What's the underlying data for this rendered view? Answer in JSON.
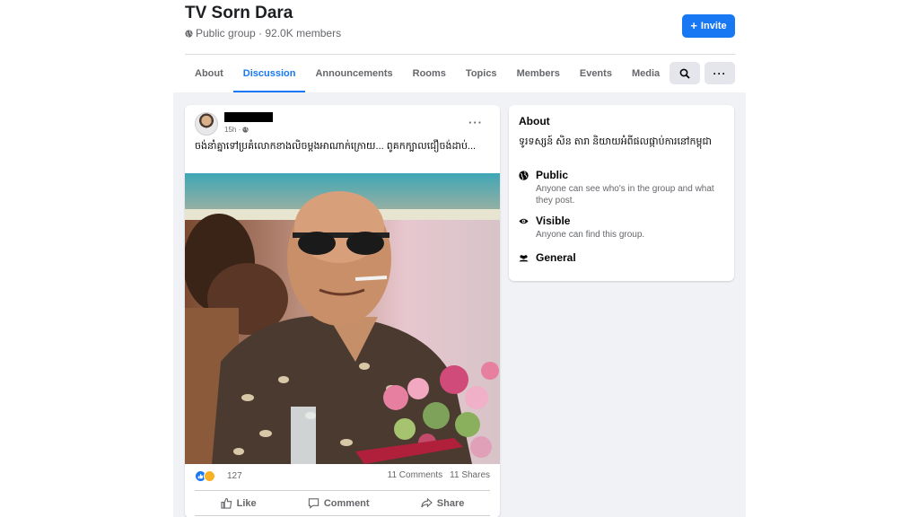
{
  "group": {
    "title": "TV Sorn Dara",
    "meta": "Public group · 92.0K members",
    "invite_label": "Invite"
  },
  "tabs": [
    {
      "label": "About",
      "active": false
    },
    {
      "label": "Discussion",
      "active": true
    },
    {
      "label": "Announcements",
      "active": false
    },
    {
      "label": "Rooms",
      "active": false
    },
    {
      "label": "Topics",
      "active": false
    },
    {
      "label": "Members",
      "active": false
    },
    {
      "label": "Events",
      "active": false
    },
    {
      "label": "Media",
      "active": false
    }
  ],
  "post": {
    "time": "15h ·",
    "text": "ចង់នាំគ្នាទៅប្រគំលោកខាងលិចម្តងអាណាក់ក្រោយ... ពូគកក្បាលជឿចង់ដាប់...",
    "reaction_count": "127",
    "comments": "11 Comments",
    "shares": "11 Shares",
    "actions": {
      "like": "Like",
      "comment": "Comment",
      "share": "Share"
    }
  },
  "about": {
    "title": "About",
    "description": "ទូរទស្សន៍ សិន តារា និយាយអំពីផលផ្កាប់ការនៅកម្ពុជា",
    "items": [
      {
        "icon": "globe-icon",
        "label": "Public",
        "sub": "Anyone can see who's in the group and what they post."
      },
      {
        "icon": "eye-icon",
        "label": "Visible",
        "sub": "Anyone can find this group."
      },
      {
        "icon": "people-icon",
        "label": "General",
        "sub": ""
      }
    ]
  },
  "colors": {
    "accent": "#1877f2",
    "background": "#f0f2f5",
    "secondary_text": "#65676b"
  }
}
